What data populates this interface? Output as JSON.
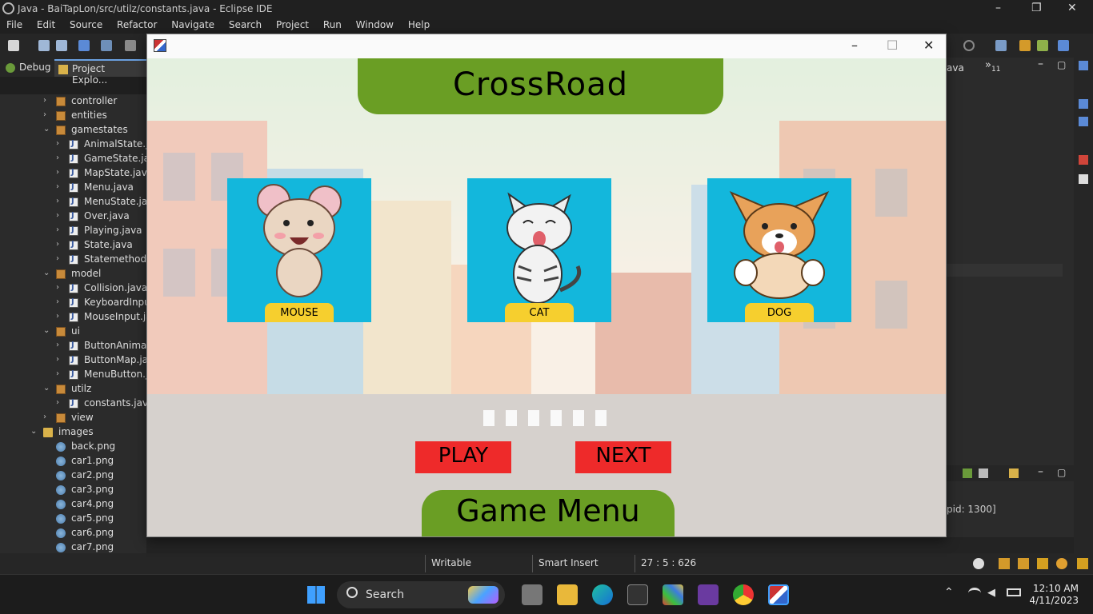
{
  "window": {
    "title": "Java - BaiTapLon/src/utilz/constants.java - Eclipse IDE"
  },
  "menu": [
    "File",
    "Edit",
    "Source",
    "Refactor",
    "Navigate",
    "Search",
    "Project",
    "Run",
    "Window",
    "Help"
  ],
  "tabs": [
    {
      "label": "Debug"
    },
    {
      "label": "Project Explo..."
    }
  ],
  "tree": [
    {
      "label": "controller",
      "type": "pkg",
      "depth": 1,
      "arrow": ">"
    },
    {
      "label": "entities",
      "type": "pkg",
      "depth": 1,
      "arrow": ">"
    },
    {
      "label": "gamestates",
      "type": "pkg",
      "depth": 1,
      "arrow": "v"
    },
    {
      "label": "AnimalState.java",
      "type": "java",
      "depth": 2,
      "arrow": ">"
    },
    {
      "label": "GameState.java",
      "type": "java",
      "depth": 2,
      "arrow": ">"
    },
    {
      "label": "MapState.java",
      "type": "java",
      "depth": 2,
      "arrow": ">"
    },
    {
      "label": "Menu.java",
      "type": "java",
      "depth": 2,
      "arrow": ">"
    },
    {
      "label": "MenuState.java",
      "type": "java",
      "depth": 2,
      "arrow": ">"
    },
    {
      "label": "Over.java",
      "type": "java",
      "depth": 2,
      "arrow": ">"
    },
    {
      "label": "Playing.java",
      "type": "java",
      "depth": 2,
      "arrow": ">"
    },
    {
      "label": "State.java",
      "type": "java",
      "depth": 2,
      "arrow": ">"
    },
    {
      "label": "Statemethods.java",
      "type": "java",
      "depth": 2,
      "arrow": ">"
    },
    {
      "label": "model",
      "type": "pkg",
      "depth": 1,
      "arrow": "v"
    },
    {
      "label": "Collision.java",
      "type": "java",
      "depth": 2,
      "arrow": ">"
    },
    {
      "label": "KeyboardInput.java",
      "type": "java",
      "depth": 2,
      "arrow": ">"
    },
    {
      "label": "MouseInput.java",
      "type": "java",
      "depth": 2,
      "arrow": ">"
    },
    {
      "label": "ui",
      "type": "pkg",
      "depth": 1,
      "arrow": "v"
    },
    {
      "label": "ButtonAnimal.java",
      "type": "java",
      "depth": 2,
      "arrow": ">"
    },
    {
      "label": "ButtonMap.java",
      "type": "java",
      "depth": 2,
      "arrow": ">"
    },
    {
      "label": "MenuButton.java",
      "type": "java",
      "depth": 2,
      "arrow": ">"
    },
    {
      "label": "utilz",
      "type": "pkg",
      "depth": 1,
      "arrow": "v"
    },
    {
      "label": "constants.java",
      "type": "java",
      "depth": 2,
      "arrow": ">"
    },
    {
      "label": "view",
      "type": "pkg",
      "depth": 1,
      "arrow": ">"
    },
    {
      "label": "images",
      "type": "folder",
      "depth": 0,
      "arrow": "v"
    },
    {
      "label": "back.png",
      "type": "png",
      "depth": 1,
      "arrow": ""
    },
    {
      "label": "car1.png",
      "type": "png",
      "depth": 1,
      "arrow": ""
    },
    {
      "label": "car2.png",
      "type": "png",
      "depth": 1,
      "arrow": ""
    },
    {
      "label": "car3.png",
      "type": "png",
      "depth": 1,
      "arrow": ""
    },
    {
      "label": "car4.png",
      "type": "png",
      "depth": 1,
      "arrow": ""
    },
    {
      "label": "car5.png",
      "type": "png",
      "depth": 1,
      "arrow": ""
    },
    {
      "label": "car6.png",
      "type": "png",
      "depth": 1,
      "arrow": ""
    },
    {
      "label": "car7.png",
      "type": "png",
      "depth": 1,
      "arrow": ""
    }
  ],
  "right_panel": {
    "tab_fragment": "ava",
    "overflow": "»",
    "overflow_count": "11",
    "console_text": "pid: 1300]"
  },
  "status": {
    "writable": "Writable",
    "insert": "Smart Insert",
    "position": "27 : 5 : 626"
  },
  "taskbar": {
    "search_label": "Search",
    "time": "12:10 AM",
    "date": "4/11/2023"
  },
  "game": {
    "title": "CrossRoad",
    "animals": [
      {
        "name": "MOUSE"
      },
      {
        "name": "CAT"
      },
      {
        "name": "DOG"
      }
    ],
    "play_label": "PLAY",
    "next_label": "NEXT",
    "footer": "Game Menu"
  },
  "colors": {
    "banner": "#6a9e24",
    "card_bg": "#13b7dc",
    "card_label": "#f6cf2e",
    "button": "#ee2a2a"
  }
}
